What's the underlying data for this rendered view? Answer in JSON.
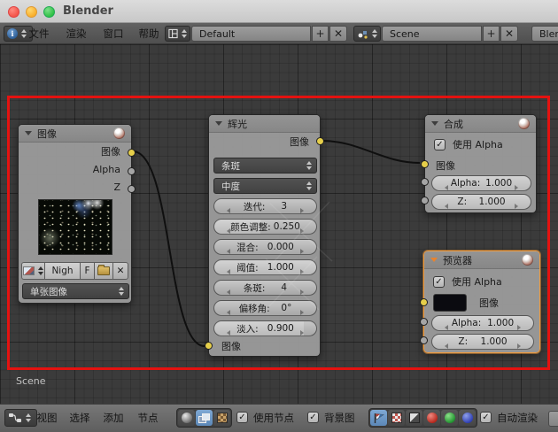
{
  "window": {
    "title": "Blender"
  },
  "topbar": {
    "menus": [
      "文件",
      "渲染",
      "窗口",
      "帮助"
    ],
    "layout_name": "Default",
    "scene_name": "Scene",
    "engine_partial": "Blen"
  },
  "editor": {
    "scene_label": "Scene",
    "image_node": {
      "title": "图像",
      "outputs": [
        "图像",
        "Alpha",
        "Z"
      ],
      "name_value": "Nigh",
      "fake_user_label": "F",
      "source": "单张图像"
    },
    "glare_node": {
      "title": "辉光",
      "output_label": "图像",
      "type_value": "条斑",
      "quality_value": "中度",
      "sliders": [
        {
          "label": "迭代:",
          "value": "3"
        },
        {
          "label": "颜色调整:",
          "value": "0.250"
        },
        {
          "label": "混合:",
          "value": "0.000"
        },
        {
          "label": "阈值:",
          "value": "1.000"
        },
        {
          "label": "条斑:",
          "value": "4"
        },
        {
          "label": "偏移角:",
          "value": "0°"
        },
        {
          "label": "淡入:",
          "value": "0.900"
        }
      ],
      "input_label": "图像"
    },
    "composite_node": {
      "title": "合成",
      "use_alpha_label": "使用 Alpha",
      "input_label": "图像",
      "alpha_label": "Alpha:",
      "alpha_value": "1.000",
      "z_label": "Z:",
      "z_value": "1.000"
    },
    "viewer_node": {
      "title": "预览器",
      "use_alpha_label": "使用 Alpha",
      "input_label": "图像",
      "alpha_label": "Alpha:",
      "alpha_value": "1.000",
      "z_label": "Z:",
      "z_value": "1.000"
    }
  },
  "bottombar": {
    "menus": [
      "视图",
      "选择",
      "添加",
      "节点"
    ],
    "use_nodes_label": "使用节点",
    "backdrop_label": "背景图",
    "auto_render_label": "自动渲染"
  },
  "glyphs": {
    "check": "✓",
    "close": "✕",
    "plus": "+",
    "info": "i"
  },
  "colors": {
    "annotation_red": "#e41210",
    "socket_yellow": "#e6cf4a",
    "socket_gray": "#a5a5a5",
    "selection_orange": "#ef9b3e",
    "highlight_blue": "#6d9ecf"
  }
}
